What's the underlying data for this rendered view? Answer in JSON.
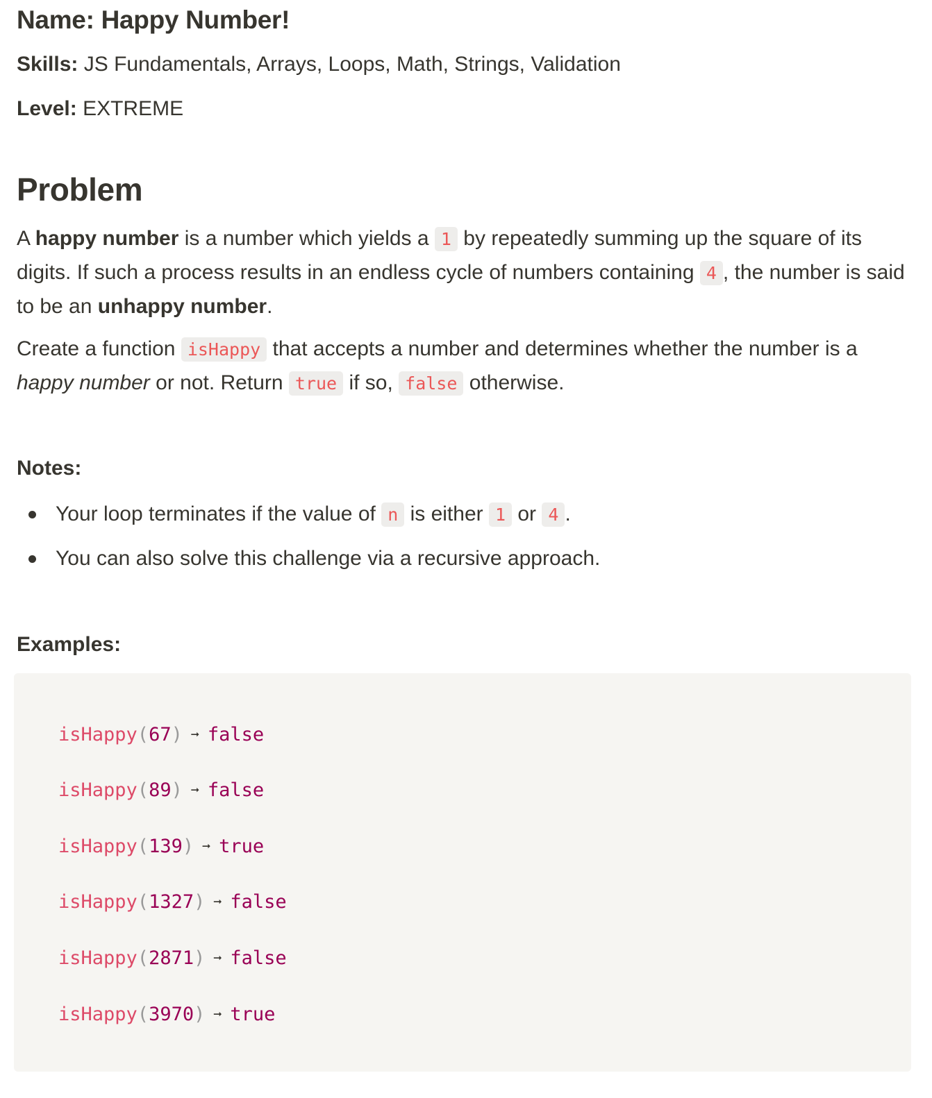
{
  "header": {
    "title": "Name: Happy Number!",
    "skills_label": "Skills:",
    "skills_value": "JS Fundamentals, Arrays, Loops, Math, Strings, Validation",
    "level_label": "Level:",
    "level_value": "EXTREME"
  },
  "problem": {
    "heading": "Problem",
    "p1": {
      "t1": "A ",
      "b1": "happy number",
      "t2": " is a number which yields a ",
      "c1": "1",
      "t3": " by repeatedly summing up the square of its digits. If such a process results in an endless cycle of numbers containing ",
      "c2": "4",
      "t4": ", the number is said to be an ",
      "b2": "unhappy number",
      "t5": "."
    },
    "p2": {
      "t1": "Create a function ",
      "c1": "isHappy",
      "t2": " that accepts a number and determines whether the number is a ",
      "i1": "happy number",
      "t3": " or not. Return ",
      "c2": "true",
      "t4": " if so, ",
      "c3": "false",
      "t5": " otherwise."
    }
  },
  "notes": {
    "label": "Notes:",
    "item1": {
      "t1": "Your loop terminates if the value of ",
      "c1": "n",
      "t2": " is either ",
      "c2": "1",
      "t3": " or ",
      "c3": "4",
      "t4": "."
    },
    "item2": "You can also solve this challenge via a recursive approach."
  },
  "examples": {
    "label": "Examples:",
    "lines": [
      {
        "fn": "isHappy",
        "open": "(",
        "arg": "67",
        "close": ")",
        "arrow": "➞",
        "result": "false"
      },
      {
        "fn": "isHappy",
        "open": "(",
        "arg": "89",
        "close": ")",
        "arrow": "➞",
        "result": "false"
      },
      {
        "fn": "isHappy",
        "open": "(",
        "arg": "139",
        "close": ")",
        "arrow": "➞",
        "result": "true"
      },
      {
        "fn": "isHappy",
        "open": "(",
        "arg": "1327",
        "close": ")",
        "arrow": "➞",
        "result": "false"
      },
      {
        "fn": "isHappy",
        "open": "(",
        "arg": "2871",
        "close": ")",
        "arrow": "➞",
        "result": "false"
      },
      {
        "fn": "isHappy",
        "open": "(",
        "arg": "3970",
        "close": ")",
        "arrow": "➞",
        "result": "true"
      }
    ]
  },
  "colors": {
    "text": "#37352f",
    "inline_code_text": "#eb5757",
    "inline_code_bg": "#eeedeb",
    "code_block_bg": "#f6f5f2",
    "code_function": "#dd4a68",
    "code_value": "#990055",
    "code_punctuation": "#999999"
  }
}
